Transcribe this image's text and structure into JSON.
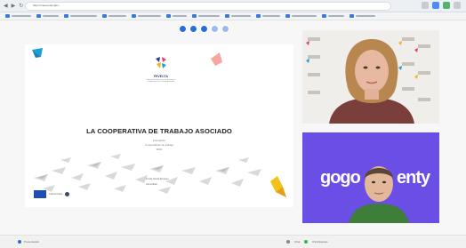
{
  "browser": {
    "url_text": "https://meet.example/...",
    "bookmark_count": 12
  },
  "controls": [
    "camera-control",
    "mic-control",
    "share-control",
    "more-control",
    "leave-control"
  ],
  "slide": {
    "logo_text": "FEVECTA",
    "logo_sub": "Federación Valenciana de Empresas Cooperativas de Trabajo Asociado",
    "title": "LA COOPERATIVA DE TRABAJO ASOCIADO",
    "subtitle_1": "Formación",
    "subtitle_2": "Cooperativas de trabajo",
    "subtitle_3": "2021",
    "bottom_text_1": "Cofinanciado",
    "bottom_text_2": "Fondo Social Europeo",
    "bottom_text_3": "Generalitat"
  },
  "tiles": {
    "brand_text": "gogo",
    "brand_suffix": "enty"
  },
  "colors": {
    "accent": "#2b6dd8",
    "tile_purple": "#6a4ee6"
  },
  "bottom_bar": {
    "left_text": "Presentando",
    "right_text_1": "Chat",
    "right_text_2": "Participantes"
  }
}
